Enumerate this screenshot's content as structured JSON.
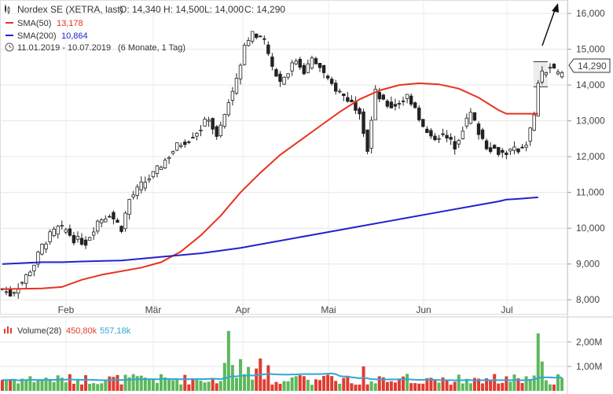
{
  "header": {
    "title": "Nordex SE (XETRA, last)",
    "ohlc": {
      "o": "O: 14,340",
      "h": "H: 14,500",
      "l": "L: 14,000",
      "c": "C: 14,290"
    },
    "sma50": {
      "label": "SMA(50)",
      "value": "13,178"
    },
    "sma200": {
      "label": "SMA(200)",
      "value": "10,864"
    },
    "period": {
      "range": "11.01.2019 - 10.07.2019",
      "detail": "(6 Monate, 1 Tag)"
    }
  },
  "volume_legend": {
    "label": "Volume(28)",
    "v1": "450,80k",
    "v2": "557,18k"
  },
  "colors": {
    "up": "#5cb85c",
    "down": "#e03c31",
    "sma50": "#e8321e",
    "sma200": "#2222cc",
    "vol_avg": "#33a6d6",
    "last_price_badge": "#ffffff"
  },
  "last_price": "14,290",
  "chart_data": [
    {
      "type": "candlestick",
      "ylim": [
        7500,
        16200
      ],
      "y_ticks": [
        8000,
        9000,
        10000,
        11000,
        12000,
        13000,
        14000,
        15000,
        16000
      ],
      "y_tick_labels": [
        "8,000",
        "9,000",
        "10,000",
        "11,000",
        "12,000",
        "13,000",
        "14,000",
        "15,000",
        "16,000"
      ],
      "x_labels": [
        "Feb",
        "Mär",
        "Apr",
        "Mai",
        "Jun",
        "Jul"
      ],
      "grid": true,
      "series": [
        {
          "name": "SMA(50)",
          "x": [
            0,
            10,
            15,
            20,
            25,
            35,
            40,
            45,
            50,
            55,
            60,
            65,
            70,
            75,
            80,
            85,
            90,
            95,
            100,
            105,
            110,
            115,
            120,
            125,
            127,
            130,
            135,
            140,
            145,
            150,
            155
          ],
          "values": [
            8300,
            8320,
            8360,
            8560,
            8700,
            8900,
            9050,
            9350,
            9800,
            10350,
            11000,
            11550,
            12050,
            12450,
            12850,
            13250,
            13600,
            13850,
            14000,
            14050,
            14020,
            13900,
            13650,
            13300,
            13200,
            13200,
            13200,
            null,
            null,
            null,
            null
          ]
        },
        {
          "name": "SMA(200)",
          "x": [
            0,
            10,
            15,
            20,
            30,
            40,
            50,
            60,
            70,
            80,
            90,
            100,
            110,
            120,
            125,
            127,
            130,
            135
          ],
          "values": [
            9000,
            9050,
            9050,
            9070,
            9100,
            9200,
            9300,
            9450,
            9650,
            9850,
            10050,
            10250,
            10450,
            10650,
            10750,
            10800,
            10820,
            10864
          ]
        }
      ],
      "annotations": [
        "consolidation box 13,950 - 14,650",
        "up arrow"
      ]
    },
    {
      "type": "bar",
      "title": "Volume(28)",
      "ylim": [
        0,
        2800000
      ],
      "y_ticks": [
        1000000,
        2000000
      ],
      "y_tick_labels": [
        "1,00M",
        "2,00M"
      ]
    }
  ]
}
